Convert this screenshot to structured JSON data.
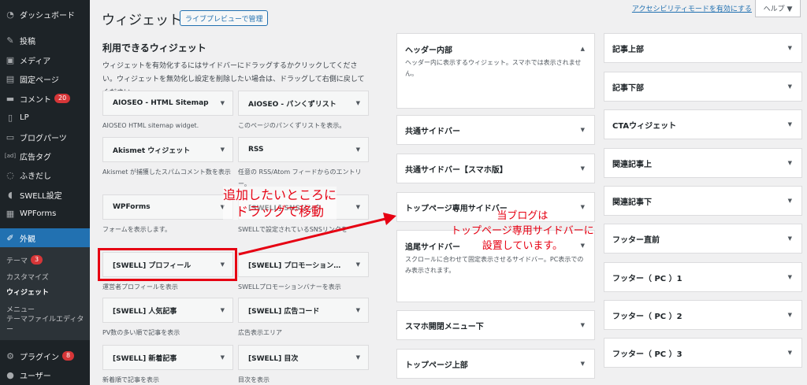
{
  "sidebar": {
    "items": [
      {
        "label": "ダッシュボード",
        "icon": "dashboard-icon",
        "glyph": "◔"
      },
      {
        "label": "投稿",
        "icon": "pin-icon",
        "glyph": "✎"
      },
      {
        "label": "メディア",
        "icon": "media-icon",
        "glyph": "▣"
      },
      {
        "label": "固定ページ",
        "icon": "page-icon",
        "glyph": "▤"
      },
      {
        "label": "コメント",
        "icon": "comment-icon",
        "glyph": "▬",
        "badge": "20"
      },
      {
        "label": "LP",
        "icon": "document-icon",
        "glyph": "▯"
      },
      {
        "label": "ブログパーツ",
        "icon": "folder-icon",
        "glyph": "▭"
      },
      {
        "label": "広告タグ",
        "icon": "ad-icon",
        "glyph": "[ad]"
      },
      {
        "label": "ふきだし",
        "icon": "speech-bubble-icon",
        "glyph": "◌"
      },
      {
        "label": "SWELL設定",
        "icon": "swell-icon",
        "glyph": "◖"
      },
      {
        "label": "WPForms",
        "icon": "forms-icon",
        "glyph": "▦"
      },
      {
        "label": "外観",
        "icon": "appearance-icon",
        "glyph": "✐"
      },
      {
        "label": "プラグイン",
        "icon": "plugin-icon",
        "glyph": "⚙",
        "badge": "8"
      },
      {
        "label": "ユーザー",
        "icon": "user-icon",
        "glyph": "●"
      }
    ],
    "submenu": [
      {
        "label": "テーマ",
        "badge": "3"
      },
      {
        "label": "カスタマイズ"
      },
      {
        "label": "ウィジェット"
      },
      {
        "label": "メニュー"
      },
      {
        "label": "テーマファイルエディター"
      }
    ]
  },
  "header": {
    "title": "ウィジェット",
    "manage_button": "ライブプレビューで管理",
    "a11y_link": "アクセシビリティモードを有効にする",
    "help": "ヘルプ ▼"
  },
  "available": {
    "title": "利用できるウィジェット",
    "description": "ウィジェットを有効化するにはサイドバーにドラッグするかクリックしてください。ウィジェットを無効化し設定を削除したい場合は、ドラッグして右側に戻してください。",
    "widgets": [
      {
        "name": "AIOSEO - HTML Sitemap",
        "desc": "AIOSEO HTML sitemap widget."
      },
      {
        "name": "AIOSEO - パンくずリスト",
        "desc": "このページのパンくずリストを表示。"
      },
      {
        "name": "Akismet ウィジェット",
        "desc": "Akismet が捕獲したスパムコメント数を表示"
      },
      {
        "name": "RSS",
        "desc": "任意の RSS/Atom フィードからのエントリー。"
      },
      {
        "name": "WPForms",
        "desc": "フォームを表示します。"
      },
      {
        "name": "[SWELL] SNSリンク",
        "desc": "SWELLで設定されているSNSリンクを"
      },
      {
        "name": "[SWELL] プロフィール",
        "desc": "運営者プロフィールを表示"
      },
      {
        "name": "[SWELL] プロモーション…",
        "desc": "SWELLプロモーションバナーを表示"
      },
      {
        "name": "[SWELL] 人気記事",
        "desc": "PV数の多い順で記事を表示"
      },
      {
        "name": "[SWELL] 広告コード",
        "desc": "広告表示エリア"
      },
      {
        "name": "[SWELL] 新着記事",
        "desc": "新着順で記事を表示"
      },
      {
        "name": "[SWELL] 目次",
        "desc": "目次を表示"
      }
    ]
  },
  "areas_col1": [
    {
      "name": "ヘッダー内部",
      "desc": "ヘッダー内に表示するウィジェット。スマホでは表示されません。",
      "open": true
    },
    {
      "name": "共通サイドバー"
    },
    {
      "name": "共通サイドバー【スマホ版】"
    },
    {
      "name": "トップページ専用サイドバー"
    },
    {
      "name": "追尾サイドバー",
      "desc": "スクロールに合わせて固定表示させるサイドバー。PC表示でのみ表示されます。"
    },
    {
      "name": "スマホ開閉メニュー下"
    },
    {
      "name": "トップページ上部"
    }
  ],
  "areas_col2": [
    {
      "name": "記事上部"
    },
    {
      "name": "記事下部"
    },
    {
      "name": "CTAウィジェット"
    },
    {
      "name": "関連記事上"
    },
    {
      "name": "関連記事下"
    },
    {
      "name": "フッター直前"
    },
    {
      "name": "フッター（ PC ）1"
    },
    {
      "name": "フッター（ PC ）2"
    },
    {
      "name": "フッター（ PC ）3"
    }
  ],
  "annotations": {
    "drag_line1": "追加したいところに",
    "drag_line2": "ドラッグで移動",
    "note_line1": "当ブログは",
    "note_line2": "トップページ専用サイドバーに",
    "note_line3": "設置しています。",
    "color": "#e60012"
  },
  "arrow_glyphs": {
    "collapsed": "▼",
    "expanded": "▲"
  }
}
